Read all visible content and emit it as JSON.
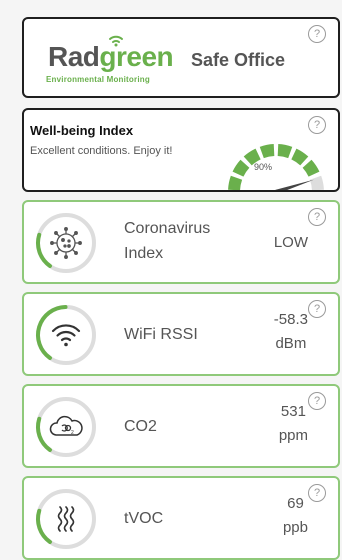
{
  "header": {
    "brand_part1": "Rad",
    "brand_part2": "green",
    "brand_tagline": "Environmental Monitoring",
    "app_name": "Safe Office",
    "help": "?"
  },
  "wellbeing": {
    "title": "Well-being Index",
    "subtitle": "Excellent conditions. Enjoy it!",
    "value_label": "90%",
    "value_fraction": 0.9,
    "help": "?"
  },
  "sensors": [
    {
      "label_line1": "Coronavirus",
      "label_line2": "Index",
      "value_line1": "LOW",
      "value_line2": "",
      "icon": "virus-icon",
      "ring_fraction": 0.2,
      "help": "?"
    },
    {
      "label_line1": "WiFi RSSI",
      "label_line2": "",
      "value_line1": "-58.3",
      "value_line2": "dBm",
      "icon": "wifi-icon",
      "ring_fraction": 0.4,
      "help": "?"
    },
    {
      "label_line1": "CO2",
      "label_line2": "",
      "value_line1": "531",
      "value_line2": "ppm",
      "icon": "cloud-co2-icon",
      "ring_fraction": 0.2,
      "help": "?"
    },
    {
      "label_line1": "tVOC",
      "label_line2": "",
      "value_line1": "69",
      "value_line2": "ppb",
      "icon": "heat-waves-icon",
      "ring_fraction": 0.2,
      "help": "?"
    }
  ],
  "colors": {
    "accent": "#6ab04c",
    "track": "#dddddd",
    "border_dark": "#1f1f1f",
    "border_green": "#8fc97a"
  }
}
